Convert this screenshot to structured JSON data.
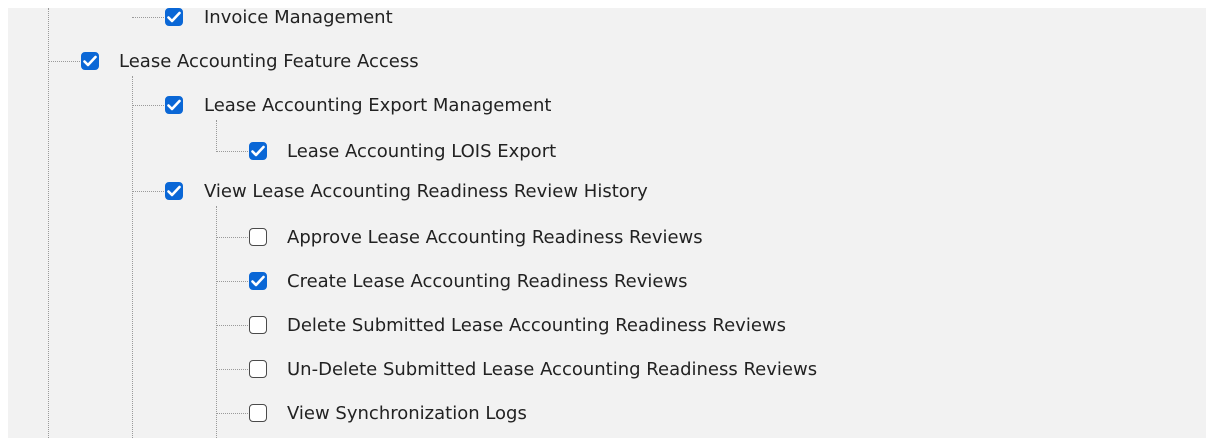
{
  "tree": {
    "items": [
      {
        "label": "Invoice Management",
        "checked": true
      },
      {
        "label": "Lease Accounting Feature Access",
        "checked": true
      },
      {
        "label": "Lease Accounting Export Management",
        "checked": true
      },
      {
        "label": "Lease Accounting LOIS Export",
        "checked": true
      },
      {
        "label": "View Lease Accounting Readiness Review History",
        "checked": true
      },
      {
        "label": "Approve Lease Accounting Readiness Reviews",
        "checked": false
      },
      {
        "label": "Create Lease Accounting Readiness Reviews",
        "checked": true
      },
      {
        "label": "Delete Submitted Lease Accounting Readiness Reviews",
        "checked": false
      },
      {
        "label": "Un-Delete Submitted Lease Accounting Readiness Reviews",
        "checked": false
      },
      {
        "label": "View Synchronization Logs",
        "checked": false
      }
    ]
  },
  "colors": {
    "checked": "#0a67d6",
    "tree_lines": "#9a9a9a",
    "background": "#f2f2f2"
  }
}
